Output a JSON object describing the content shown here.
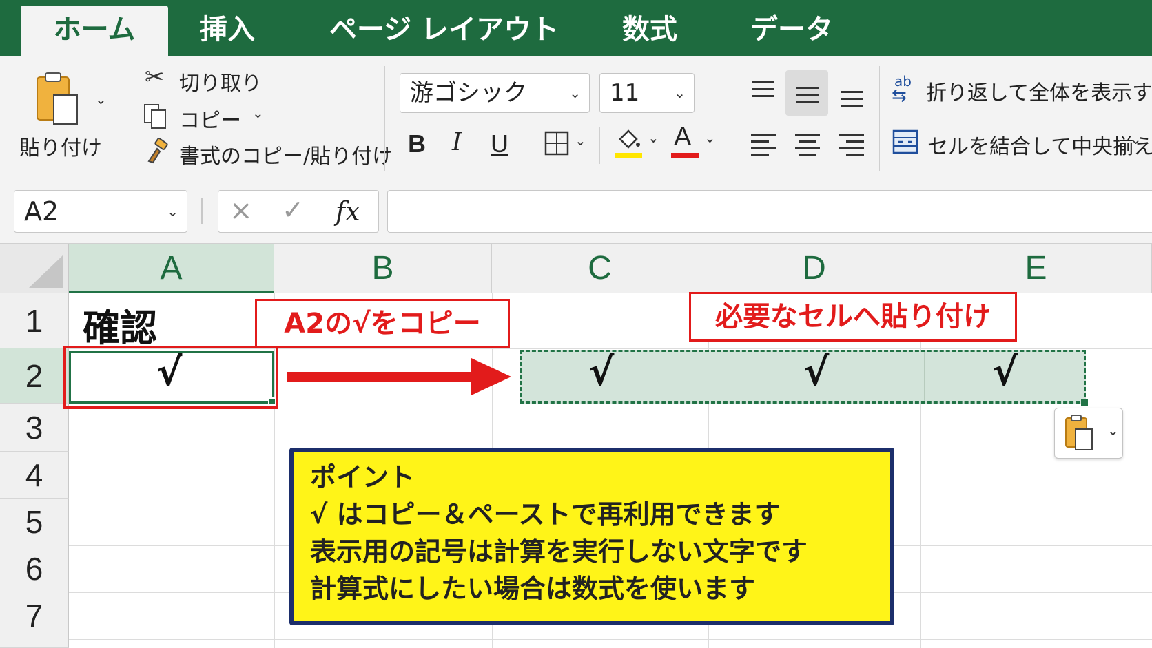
{
  "tabs": [
    "ホーム",
    "挿入",
    "ページ レイアウト",
    "数式",
    "データ"
  ],
  "clipboard": {
    "paste_label": "貼り付け",
    "cut_label": "切り取り",
    "copy_label": "コピー",
    "format_painter_label": "書式のコピー/貼り付け"
  },
  "font": {
    "name": "游ゴシック",
    "size": "11",
    "bold": "B",
    "italic": "I",
    "underline": "U",
    "font_color_glyph": "A",
    "fill_color": "#ffe600",
    "font_color": "#e21b1b"
  },
  "alignment": {
    "wrap_text_label": "折り返して全体を表示する",
    "wrap_icon_text": "ab",
    "merge_center_label": "セルを結合して中央揃え"
  },
  "formula_bar": {
    "name_box": "A2",
    "cancel": "×",
    "enter": "✓",
    "fx": "fx",
    "formula": ""
  },
  "grid": {
    "columns": [
      "A",
      "B",
      "C",
      "D",
      "E"
    ],
    "rows": [
      "1",
      "2",
      "3",
      "4",
      "5",
      "6",
      "7"
    ],
    "cells": {
      "A1": "確認",
      "A2": "√",
      "C2": "√",
      "D2": "√",
      "E2": "√"
    }
  },
  "annotations": {
    "copy_callout": "A2の√をコピー",
    "paste_callout": "必要なセルへ貼り付け",
    "point_title": "ポイント",
    "point_lines": [
      " √ はコピー＆ペーストで再利用できます",
      " 表示用の記号は計算を実行しない文字です",
      " 計算式にしたい場合は数式を使います"
    ]
  },
  "colors": {
    "excel_green": "#1e6b3f",
    "callout_red": "#e21b1b",
    "point_yellow": "#fff418",
    "point_border": "#1c2e6b"
  }
}
